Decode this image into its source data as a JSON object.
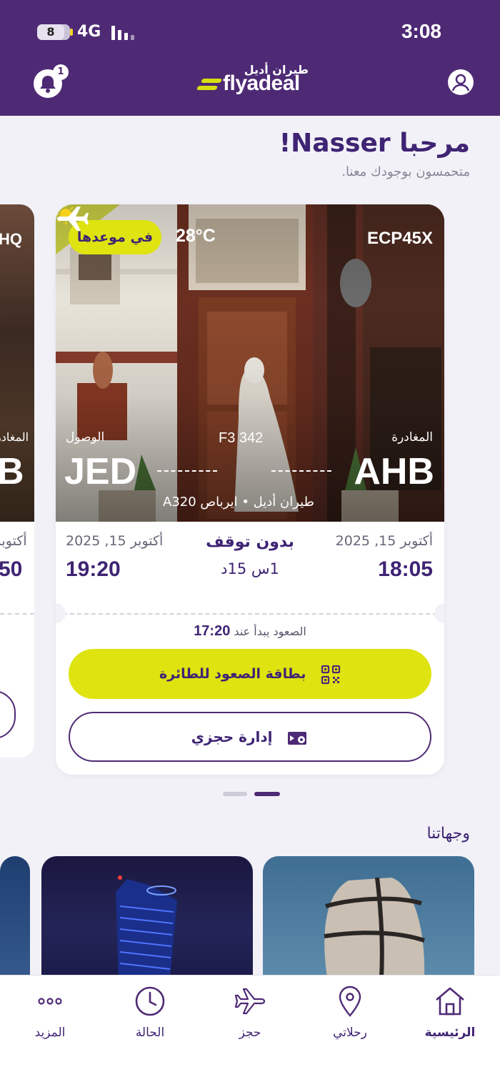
{
  "status_bar": {
    "battery": "8",
    "network": "4G",
    "time": "3:08"
  },
  "header": {
    "notification_count": "1",
    "logo_ar": "طيران أديل",
    "logo_en": "flyadeal"
  },
  "welcome": {
    "title": "مرحبا Nasser!",
    "subtitle": "متحمسون بوجودك معنا."
  },
  "side_card_left": {
    "code_fragment": "HQ",
    "label_fragment": "المغادر",
    "airport_fragment": "B",
    "date_fragment": "أكتوبر",
    "time_fragment": "50"
  },
  "trip_card": {
    "status": "في موعدها",
    "temperature": "28°C",
    "booking_ref": "ECP45X",
    "arrival_label": "الوصول",
    "departure_label": "المغادرة",
    "flight_number": "F3 342",
    "arrival_code": "JED",
    "departure_code": "AHB",
    "aircraft": "طيران أديل • ايرباص A320",
    "arrival_date": "أكتوبر 15, 2025",
    "departure_date": "أكتوبر 15, 2025",
    "arrival_time": "19:20",
    "departure_time": "18:05",
    "stops": "بدون توقف",
    "duration": "1س 15د",
    "boarding_label": "الصعود يبدأ عند",
    "boarding_time": "17:20",
    "boarding_pass_button": "بطاقة الصعود للطائرة",
    "manage_booking_button": "إدارة حجزي"
  },
  "carousel": {
    "pages": 2,
    "active_page": 2
  },
  "destinations": {
    "title": "وجهاتنا"
  },
  "bottom_nav": {
    "items": [
      {
        "label": "الرئيسية",
        "icon": "home-icon",
        "active": true
      },
      {
        "label": "رحلاتي",
        "icon": "location-pin-icon",
        "active": false
      },
      {
        "label": "حجز",
        "icon": "airplane-icon",
        "active": false
      },
      {
        "label": "الحالة",
        "icon": "clock-icon",
        "active": false
      },
      {
        "label": "المزيد",
        "icon": "more-dots-icon",
        "active": false
      }
    ]
  },
  "colors": {
    "brand_purple": "#4e2a75",
    "brand_lime": "#dfe30f",
    "background": "#f2f1f7"
  }
}
